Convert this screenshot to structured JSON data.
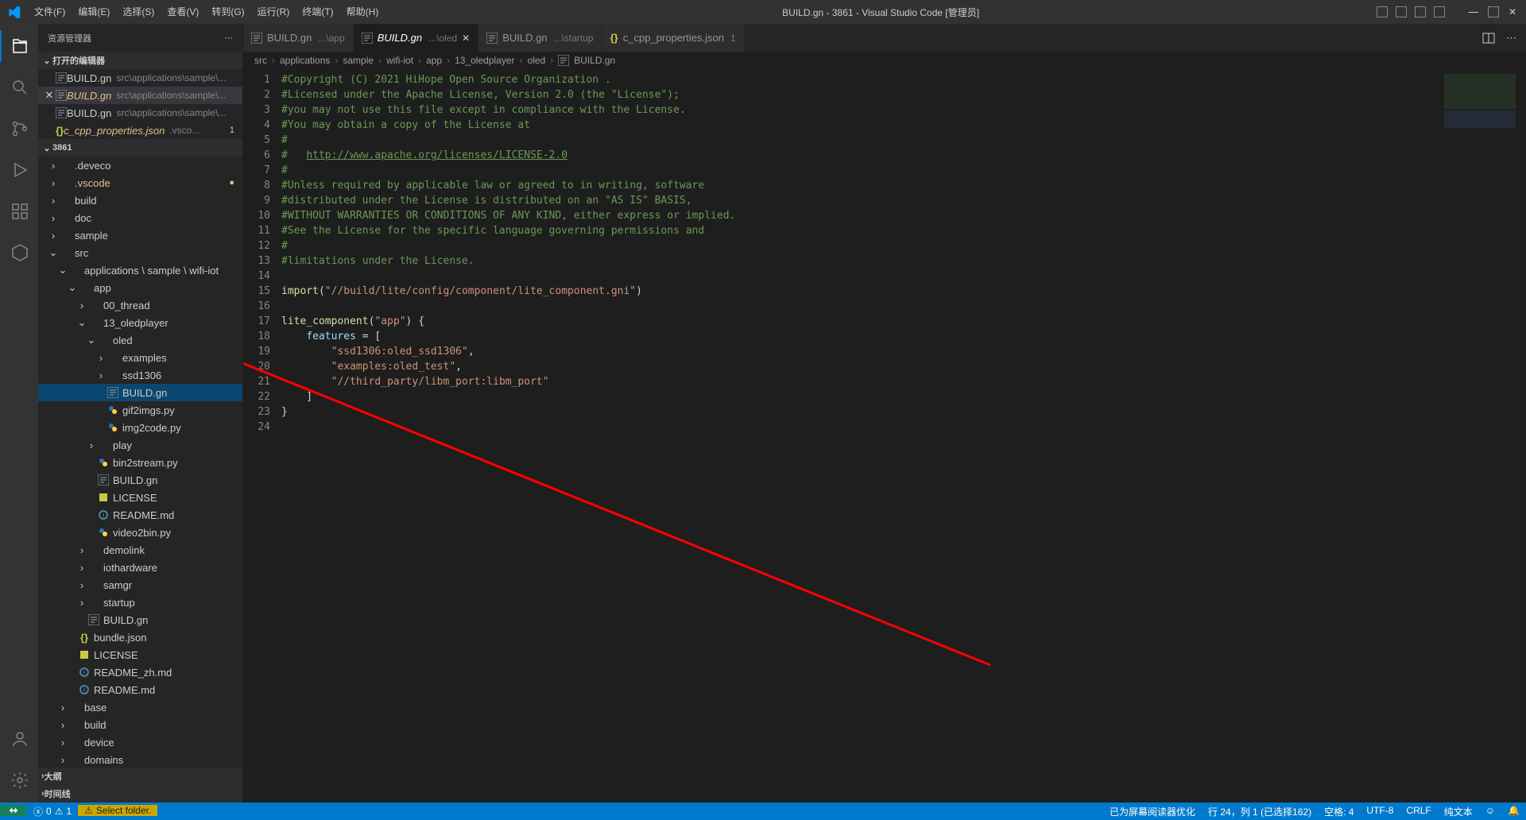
{
  "titlebar": {
    "title": "BUILD.gn - 3861 - Visual Studio Code [管理员]",
    "menu": [
      "文件(F)",
      "编辑(E)",
      "选择(S)",
      "查看(V)",
      "转到(G)",
      "运行(R)",
      "终端(T)",
      "帮助(H)"
    ]
  },
  "sidebar": {
    "title": "资源管理器",
    "open_editors_hdr": "打开的编辑器",
    "open_editors": [
      {
        "name": "BUILD.gn",
        "path": "src\\applications\\sample\\...",
        "modified": false,
        "active": false,
        "name_cls": "",
        "close": ""
      },
      {
        "name": "BUILD.gn",
        "path": "src\\applications\\sample\\...",
        "modified": true,
        "active": true,
        "name_cls": "mod",
        "close": "✕"
      },
      {
        "name": "BUILD.gn",
        "path": "src\\applications\\sample\\...",
        "modified": false,
        "active": false,
        "name_cls": "",
        "close": ""
      },
      {
        "name": "c_cpp_properties.json",
        "path": ".vsco...",
        "modified": false,
        "active": false,
        "name_cls": "mod",
        "badge": "1",
        "close": ""
      }
    ],
    "project_name": "3861",
    "tree": [
      {
        "indent": 12,
        "tw": "›",
        "icon": "folder",
        "label": ".deveco",
        "cls": ""
      },
      {
        "indent": 12,
        "tw": "›",
        "icon": "folder",
        "label": ".vscode",
        "cls": "mod",
        "trail": "●"
      },
      {
        "indent": 12,
        "tw": "›",
        "icon": "folder",
        "label": "build",
        "cls": ""
      },
      {
        "indent": 12,
        "tw": "›",
        "icon": "folder",
        "label": "doc",
        "cls": ""
      },
      {
        "indent": 12,
        "tw": "›",
        "icon": "folder",
        "label": "sample",
        "cls": ""
      },
      {
        "indent": 12,
        "tw": "⌄",
        "icon": "folder-open",
        "label": "src",
        "cls": ""
      },
      {
        "indent": 24,
        "tw": "⌄",
        "icon": "folder-open",
        "label": "applications \\ sample \\ wifi-iot",
        "cls": ""
      },
      {
        "indent": 36,
        "tw": "⌄",
        "icon": "folder-open",
        "label": "app",
        "cls": ""
      },
      {
        "indent": 48,
        "tw": "›",
        "icon": "folder",
        "label": "00_thread",
        "cls": ""
      },
      {
        "indent": 48,
        "tw": "⌄",
        "icon": "folder-open",
        "label": "13_oledplayer",
        "cls": ""
      },
      {
        "indent": 60,
        "tw": "⌄",
        "icon": "folder-open",
        "label": "oled",
        "cls": ""
      },
      {
        "indent": 72,
        "tw": "›",
        "icon": "folder",
        "label": "examples",
        "cls": ""
      },
      {
        "indent": 72,
        "tw": "›",
        "icon": "folder",
        "label": "ssd1306",
        "cls": ""
      },
      {
        "indent": 72,
        "tw": "",
        "icon": "gn",
        "label": "BUILD.gn",
        "cls": "",
        "selected": true
      },
      {
        "indent": 72,
        "tw": "",
        "icon": "py",
        "label": "gif2imgs.py",
        "cls": ""
      },
      {
        "indent": 72,
        "tw": "",
        "icon": "py",
        "label": "img2code.py",
        "cls": ""
      },
      {
        "indent": 60,
        "tw": "›",
        "icon": "folder",
        "label": "play",
        "cls": ""
      },
      {
        "indent": 60,
        "tw": "",
        "icon": "py",
        "label": "bin2stream.py",
        "cls": ""
      },
      {
        "indent": 60,
        "tw": "",
        "icon": "gn",
        "label": "BUILD.gn",
        "cls": ""
      },
      {
        "indent": 60,
        "tw": "",
        "icon": "lic",
        "label": "LICENSE",
        "cls": ""
      },
      {
        "indent": 60,
        "tw": "",
        "icon": "md",
        "label": "README.md",
        "cls": ""
      },
      {
        "indent": 60,
        "tw": "",
        "icon": "py",
        "label": "video2bin.py",
        "cls": ""
      },
      {
        "indent": 48,
        "tw": "›",
        "icon": "folder",
        "label": "demolink",
        "cls": ""
      },
      {
        "indent": 48,
        "tw": "›",
        "icon": "folder",
        "label": "iothardware",
        "cls": ""
      },
      {
        "indent": 48,
        "tw": "›",
        "icon": "folder",
        "label": "samgr",
        "cls": ""
      },
      {
        "indent": 48,
        "tw": "›",
        "icon": "folder",
        "label": "startup",
        "cls": ""
      },
      {
        "indent": 48,
        "tw": "",
        "icon": "gn",
        "label": "BUILD.gn",
        "cls": ""
      },
      {
        "indent": 36,
        "tw": "",
        "icon": "json",
        "label": "bundle.json",
        "cls": ""
      },
      {
        "indent": 36,
        "tw": "",
        "icon": "lic",
        "label": "LICENSE",
        "cls": ""
      },
      {
        "indent": 36,
        "tw": "",
        "icon": "md",
        "label": "README_zh.md",
        "cls": ""
      },
      {
        "indent": 36,
        "tw": "",
        "icon": "md",
        "label": "README.md",
        "cls": ""
      },
      {
        "indent": 24,
        "tw": "›",
        "icon": "folder",
        "label": "base",
        "cls": ""
      },
      {
        "indent": 24,
        "tw": "›",
        "icon": "folder",
        "label": "build",
        "cls": ""
      },
      {
        "indent": 24,
        "tw": "›",
        "icon": "folder",
        "label": "device",
        "cls": ""
      },
      {
        "indent": 24,
        "tw": "›",
        "icon": "folder",
        "label": "domains",
        "cls": ""
      }
    ],
    "outline_hdr": "大纲",
    "timeline_hdr": "时间线"
  },
  "tabs": [
    {
      "icon": "gn",
      "name": "BUILD.gn",
      "desc": "...\\app",
      "mod": false,
      "active": false
    },
    {
      "icon": "gn",
      "name": "BUILD.gn",
      "desc": "...\\oled",
      "mod": true,
      "active": true
    },
    {
      "icon": "gn",
      "name": "BUILD.gn",
      "desc": "...\\startup",
      "mod": false,
      "active": false
    },
    {
      "icon": "json",
      "name": "c_cpp_properties.json",
      "desc": "1",
      "mod": false,
      "active": false,
      "desc_cls": "mod"
    }
  ],
  "breadcrumb": [
    "src",
    "applications",
    "sample",
    "wifi-iot",
    "app",
    "13_oledplayer",
    "oled",
    "BUILD.gn"
  ],
  "code": {
    "lines": [
      {
        "n": 1,
        "seg": [
          {
            "t": "#Copyright (C) 2021 HiHope Open Source Organization .",
            "c": "c-comment"
          }
        ]
      },
      {
        "n": 2,
        "seg": [
          {
            "t": "#Licensed under the Apache License, Version 2.0 (the \"License\");",
            "c": "c-comment"
          }
        ]
      },
      {
        "n": 3,
        "seg": [
          {
            "t": "#you may not use this file except in compliance with the License.",
            "c": "c-comment"
          }
        ]
      },
      {
        "n": 4,
        "seg": [
          {
            "t": "#You may obtain a copy of the License at",
            "c": "c-comment"
          }
        ]
      },
      {
        "n": 5,
        "seg": [
          {
            "t": "#",
            "c": "c-comment"
          }
        ]
      },
      {
        "n": 6,
        "seg": [
          {
            "t": "#   ",
            "c": "c-comment"
          },
          {
            "t": "http://www.apache.org/licenses/LICENSE-2.0",
            "c": "c-link"
          }
        ]
      },
      {
        "n": 7,
        "seg": [
          {
            "t": "#",
            "c": "c-comment"
          }
        ]
      },
      {
        "n": 8,
        "seg": [
          {
            "t": "#Unless required by applicable law or agreed to in writing, software",
            "c": "c-comment"
          }
        ]
      },
      {
        "n": 9,
        "seg": [
          {
            "t": "#distributed under the License is distributed on an \"AS IS\" BASIS,",
            "c": "c-comment"
          }
        ]
      },
      {
        "n": 10,
        "seg": [
          {
            "t": "#WITHOUT WARRANTIES OR CONDITIONS OF ANY KIND, either express or implied.",
            "c": "c-comment"
          }
        ]
      },
      {
        "n": 11,
        "seg": [
          {
            "t": "#See the License for the specific language governing permissions and",
            "c": "c-comment"
          }
        ]
      },
      {
        "n": 12,
        "seg": [
          {
            "t": "#",
            "c": "c-comment"
          }
        ]
      },
      {
        "n": 13,
        "seg": [
          {
            "t": "#limitations under the License.",
            "c": "c-comment"
          }
        ]
      },
      {
        "n": 14,
        "seg": []
      },
      {
        "n": 15,
        "seg": [
          {
            "t": "import",
            "c": "c-func"
          },
          {
            "t": "(",
            "c": "c-punct"
          },
          {
            "t": "\"//build/lite/config/component/lite_component.gni\"",
            "c": "c-string"
          },
          {
            "t": ")",
            "c": "c-punct"
          }
        ]
      },
      {
        "n": 16,
        "seg": []
      },
      {
        "n": 17,
        "seg": [
          {
            "t": "lite_component",
            "c": "c-func"
          },
          {
            "t": "(",
            "c": "c-punct"
          },
          {
            "t": "\"app\"",
            "c": "c-string"
          },
          {
            "t": ") {",
            "c": "c-punct"
          }
        ]
      },
      {
        "n": 18,
        "seg": [
          {
            "t": "    ",
            "c": ""
          },
          {
            "t": "features",
            "c": "c-ident"
          },
          {
            "t": " = [",
            "c": "c-punct"
          }
        ]
      },
      {
        "n": 19,
        "seg": [
          {
            "t": "        ",
            "c": ""
          },
          {
            "t": "\"ssd1306:oled_ssd1306\"",
            "c": "c-string"
          },
          {
            "t": ",",
            "c": "c-punct"
          }
        ]
      },
      {
        "n": 20,
        "seg": [
          {
            "t": "        ",
            "c": ""
          },
          {
            "t": "\"examples:oled_test\"",
            "c": "c-string"
          },
          {
            "t": ",",
            "c": "c-punct"
          }
        ]
      },
      {
        "n": 21,
        "seg": [
          {
            "t": "        ",
            "c": ""
          },
          {
            "t": "\"//third_party/libm_port:libm_port\"",
            "c": "c-string"
          }
        ]
      },
      {
        "n": 22,
        "seg": [
          {
            "t": "    ]",
            "c": "c-punct"
          }
        ]
      },
      {
        "n": 23,
        "seg": [
          {
            "t": "}",
            "c": "c-punct"
          }
        ]
      },
      {
        "n": 24,
        "seg": []
      }
    ]
  },
  "statusbar": {
    "errors": "0",
    "warnings": "1",
    "select_folder": "Select folder.",
    "screen_reader": "已为屏幕阅读器优化",
    "lncol": "行 24，列 1 (已选择162)",
    "spaces": "空格: 4",
    "encoding": "UTF-8",
    "eol": "CRLF",
    "lang": "纯文本",
    "feedback": "",
    "notifications": ""
  }
}
